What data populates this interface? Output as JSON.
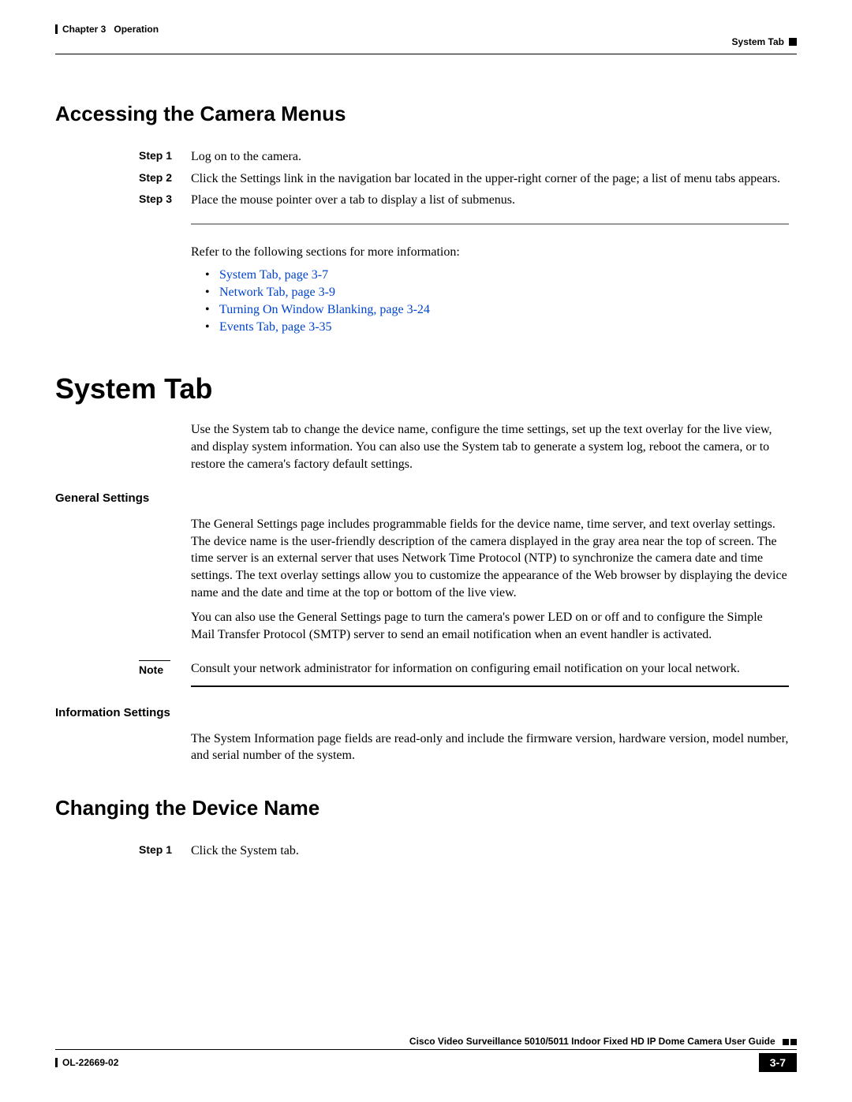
{
  "header": {
    "chapter_label": "Chapter 3",
    "chapter_title": "Operation",
    "section": "System Tab"
  },
  "section1": {
    "heading": "Accessing the Camera Menus",
    "steps": [
      {
        "label": "Step 1",
        "text": "Log on to the camera."
      },
      {
        "label": "Step 2",
        "text": "Click the Settings link in the navigation bar located in the upper-right corner of the page; a list of menu tabs appears."
      },
      {
        "label": "Step 3",
        "text": "Place the mouse pointer over a tab to display a list of submenus."
      }
    ],
    "refer_text": "Refer to the following sections for more information:",
    "links": [
      "System Tab, page 3-7",
      "Network Tab, page 3-9",
      "Turning On Window Blanking, page 3-24",
      "Events Tab, page 3-35"
    ]
  },
  "section2": {
    "heading": "System Tab",
    "intro": "Use the System tab to change the device name, configure the time settings, set up the text overlay for the live view, and display system information. You can also use the System tab to generate a system log, reboot the camera, or to restore the camera's factory default settings.",
    "sub1": {
      "heading": "General Settings",
      "p1": "The General Settings page includes programmable fields for the device name, time server, and text overlay settings. The device name is the   user-friendly description of the camera displayed in the gray area near the top of screen. The time server is an external server that uses Network Time Protocol (NTP) to synchronize the camera date and time settings. The text overlay settings allow you to customize the appearance of the Web browser by displaying the device name and the date and time at the top or bottom of the live view.",
      "p2": "You can also use the General Settings page to turn the camera's power LED on or off and to configure the Simple Mail Transfer Protocol (SMTP) server to send an email notification when an event handler is activated.",
      "note_label": "Note",
      "note_text": "Consult your network administrator for information on configuring email notification on your local network."
    },
    "sub2": {
      "heading": "Information Settings",
      "p1": "The System Information page fields are read-only and include the firmware version, hardware version, model number, and serial number of the system."
    }
  },
  "section3": {
    "heading": "Changing the Device Name",
    "steps": [
      {
        "label": "Step 1",
        "text": "Click the System tab."
      }
    ]
  },
  "footer": {
    "guide": "Cisco Video Surveillance 5010/5011 Indoor Fixed HD IP Dome Camera User Guide",
    "doc_id": "OL-22669-02",
    "page": "3-7"
  }
}
